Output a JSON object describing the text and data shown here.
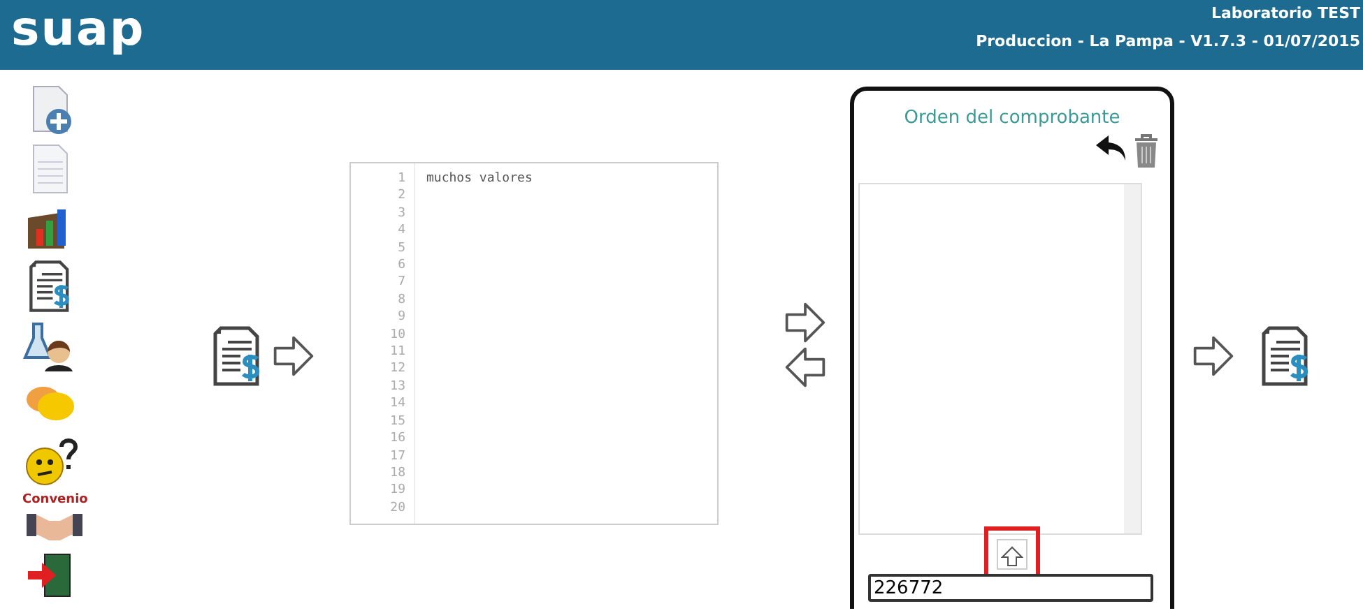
{
  "header": {
    "logo": "suap",
    "lab": "Laboratorio TEST",
    "version": "Produccion - La Pampa - V1.7.3 - 01/07/2015"
  },
  "sidebar": {
    "items": [
      {
        "kind": "add-document"
      },
      {
        "kind": "sheet"
      },
      {
        "kind": "chart"
      },
      {
        "kind": "invoice"
      },
      {
        "kind": "lab-person"
      },
      {
        "kind": "chat"
      },
      {
        "kind": "question"
      },
      {
        "kind": "handshake",
        "label": "Convenio"
      },
      {
        "kind": "exit"
      }
    ]
  },
  "editor": {
    "lines": [
      {
        "number": "1",
        "text": "muchos valores"
      },
      {
        "number": "2"
      },
      {
        "number": "3"
      },
      {
        "number": "4"
      },
      {
        "number": "5"
      },
      {
        "number": "6"
      },
      {
        "number": "7"
      },
      {
        "number": "8"
      },
      {
        "number": "9"
      },
      {
        "number": "10"
      },
      {
        "number": "11"
      },
      {
        "number": "12"
      },
      {
        "number": "13"
      },
      {
        "number": "14"
      },
      {
        "number": "15"
      },
      {
        "number": "16"
      },
      {
        "number": "17"
      },
      {
        "number": "18"
      },
      {
        "number": "19"
      },
      {
        "number": "20"
      }
    ]
  },
  "panel": {
    "title": "Orden del comprobante",
    "code_field": {
      "value": "226772"
    },
    "up_button": {
      "highlighted": true
    }
  }
}
